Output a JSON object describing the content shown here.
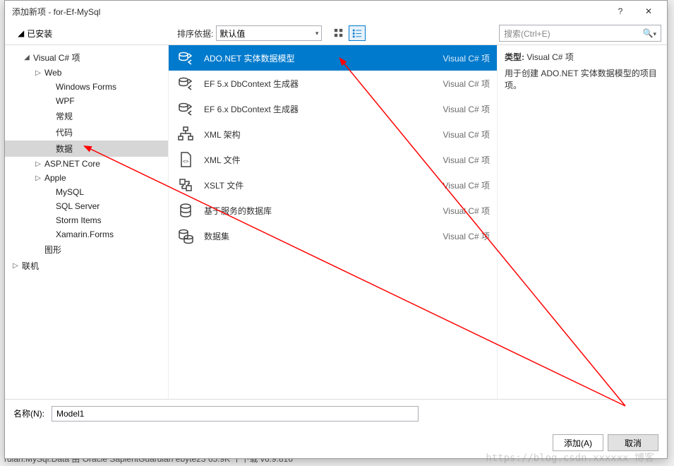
{
  "window": {
    "title": "添加新项 - for-Ef-MySql",
    "help": "?",
    "close": "✕"
  },
  "topbar": {
    "installed_root": "已安装",
    "sort_label": "排序依据:",
    "sort_value": "默认值",
    "search_placeholder": "搜索(Ctrl+E)"
  },
  "tree": {
    "items": [
      {
        "lvl": 0,
        "exp": "◢",
        "label": "已安装"
      },
      {
        "lvl": 1,
        "exp": "◢",
        "label": "Visual C# 项"
      },
      {
        "lvl": 2,
        "exp": "▷",
        "label": "Web"
      },
      {
        "lvl": 3,
        "exp": "",
        "label": "Windows Forms"
      },
      {
        "lvl": 3,
        "exp": "",
        "label": "WPF"
      },
      {
        "lvl": 3,
        "exp": "",
        "label": "常规"
      },
      {
        "lvl": 3,
        "exp": "",
        "label": "代码"
      },
      {
        "lvl": 3,
        "exp": "",
        "label": "数据",
        "selected": true
      },
      {
        "lvl": 2,
        "exp": "▷",
        "label": "ASP.NET Core"
      },
      {
        "lvl": 2,
        "exp": "▷",
        "label": "Apple"
      },
      {
        "lvl": 3,
        "exp": "",
        "label": "MySQL"
      },
      {
        "lvl": 3,
        "exp": "",
        "label": "SQL Server"
      },
      {
        "lvl": 3,
        "exp": "",
        "label": "Storm Items"
      },
      {
        "lvl": 3,
        "exp": "",
        "label": "Xamarin.Forms"
      },
      {
        "lvl": 2,
        "exp": "",
        "label": "图形"
      },
      {
        "lvl": 0,
        "exp": "▷",
        "label": "联机"
      }
    ]
  },
  "list": {
    "type_label": "Visual C# 项",
    "items": [
      {
        "label": "ADO.NET 实体数据模型",
        "selected": true,
        "icon": "db-arrows"
      },
      {
        "label": "EF 5.x DbContext 生成器",
        "icon": "db-arrows"
      },
      {
        "label": "EF 6.x DbContext 生成器",
        "icon": "db-arrows"
      },
      {
        "label": "XML 架构",
        "icon": "xml-tree"
      },
      {
        "label": "XML 文件",
        "icon": "xml-file"
      },
      {
        "label": "XSLT 文件",
        "icon": "xslt"
      },
      {
        "label": "基于服务的数据库",
        "icon": "db"
      },
      {
        "label": "数据集",
        "icon": "db-set"
      }
    ]
  },
  "info": {
    "type_prefix": "类型:",
    "type_value": "Visual C# 项",
    "desc": "用于创建 ADO.NET 实体数据模型的项目项。"
  },
  "bottom": {
    "name_label": "名称(N):",
    "name_value": "Model1",
    "add": "添加(A)",
    "cancel": "取消"
  },
  "watermark": "https://blog.csdn.xxxxxx 博客",
  "bg_partial": "rdian.MySql.Data 由 Oracle  SapientGuardian  ebyte23   65.9K 个下载                                                          v6.9.816"
}
